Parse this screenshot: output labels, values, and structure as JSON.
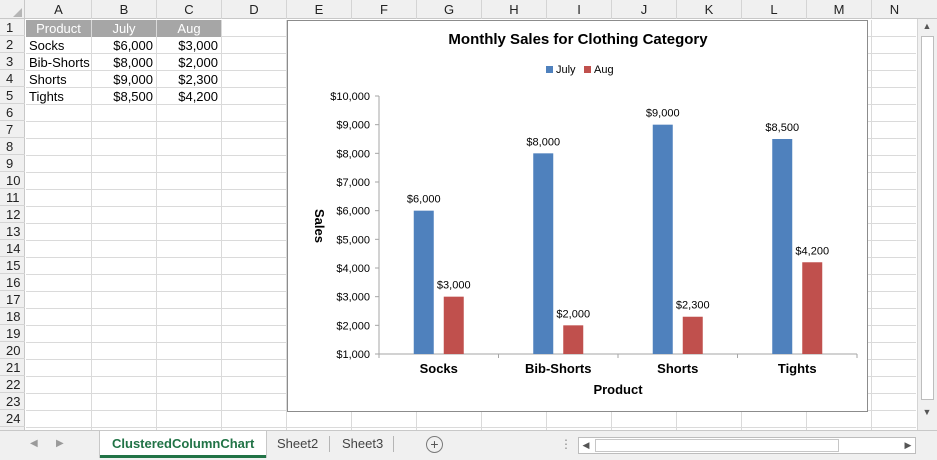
{
  "columns": [
    "A",
    "B",
    "C",
    "D",
    "E",
    "F",
    "G",
    "H",
    "I",
    "J",
    "K",
    "L",
    "M",
    "N"
  ],
  "rows": [
    "1",
    "2",
    "3",
    "4",
    "5",
    "6",
    "7",
    "8",
    "9",
    "10",
    "11",
    "12",
    "13",
    "14",
    "15",
    "16",
    "17",
    "18",
    "19",
    "20",
    "21",
    "22",
    "23",
    "24"
  ],
  "table": {
    "headers": [
      "Product",
      "July",
      "Aug"
    ],
    "rows": [
      [
        "Socks",
        "$6,000",
        "$3,000"
      ],
      [
        "Bib-Shorts",
        "$8,000",
        "$2,000"
      ],
      [
        "Shorts",
        "$9,000",
        "$2,300"
      ],
      [
        "Tights",
        "$8,500",
        "$4,200"
      ]
    ]
  },
  "chart_data": {
    "type": "bar",
    "title": "Monthly Sales for Clothing Category",
    "xlabel": "Product",
    "ylabel": "Sales",
    "categories": [
      "Socks",
      "Bib-Shorts",
      "Shorts",
      "Tights"
    ],
    "series": [
      {
        "name": "July",
        "values": [
          6000,
          8000,
          9000,
          8500
        ],
        "labels": [
          "$6,000",
          "$8,000",
          "$9,000",
          "$8,500"
        ],
        "color": "#4f81bd"
      },
      {
        "name": "Aug",
        "values": [
          3000,
          2000,
          2300,
          4200
        ],
        "labels": [
          "$3,000",
          "$2,000",
          "$2,300",
          "$4,200"
        ],
        "color": "#c0504d"
      }
    ],
    "ylim": [
      1000,
      10000
    ],
    "yticks": [
      1000,
      2000,
      3000,
      4000,
      5000,
      6000,
      7000,
      8000,
      9000,
      10000
    ],
    "yticklabels": [
      "$1,000",
      "$2,000",
      "$3,000",
      "$4,000",
      "$5,000",
      "$6,000",
      "$7,000",
      "$8,000",
      "$9,000",
      "$10,000"
    ],
    "grid": false,
    "legend": "top"
  },
  "tabs": [
    {
      "label": "ClusteredColumnChart",
      "active": true
    },
    {
      "label": "Sheet2",
      "active": false
    },
    {
      "label": "Sheet3",
      "active": false
    }
  ],
  "icons": {
    "nav_prev": "◀",
    "nav_next": "▶",
    "add_sheet": "+",
    "scroll_up": "▲",
    "scroll_down": "▼",
    "scroll_left": "◀",
    "scroll_right": "▶",
    "more": "⋮"
  },
  "colors": {
    "accent": "#217346",
    "header_fill": "#a6a6a6"
  }
}
